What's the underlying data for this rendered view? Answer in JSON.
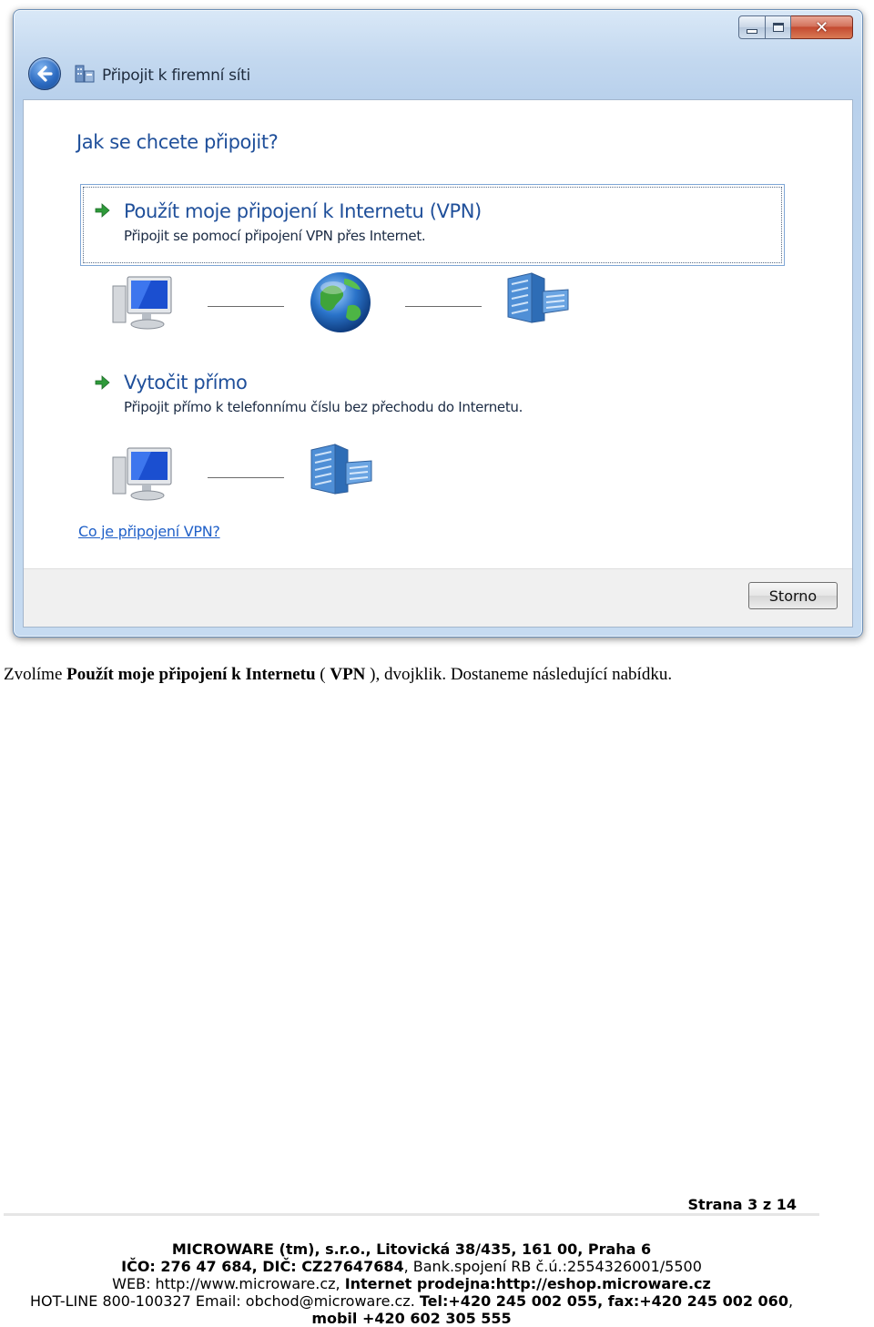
{
  "window": {
    "title": "Připojit k firemní síti",
    "question": "Jak se chcete připojit?",
    "options": [
      {
        "title": "Použít moje připojení k Internetu (VPN)",
        "desc": "Připojit se pomocí připojení VPN přes Internet."
      },
      {
        "title": "Vytočit přímo",
        "desc": "Připojit přímo k telefonnímu číslu bez přechodu do Internetu."
      }
    ],
    "help_link": "Co je připojení VPN?",
    "cancel_label": "Storno",
    "icons": [
      "back-arrow-icon",
      "network-icon",
      "computer-icon",
      "globe-icon",
      "server-building-icon",
      "green-arrow-icon"
    ]
  },
  "doc": {
    "p1_a": "Zvolíme ",
    "p1_b": "Použít moje připojení k Internetu",
    "p1_c": " ( ",
    "p1_d": "VPN",
    "p1_e": " ), dvojklik. Dostaneme následující nabídku."
  },
  "page": {
    "label": "Strana 3 z 14"
  },
  "footer": {
    "line1": "MICROWARE (tm), s.r.o., Litovická 38/435, 161 00, Praha 6",
    "line2_a": "IČO: 276 47 684,   DIČ: CZ27647684",
    "line2_b": ",     Bank.spojení RB č.ú.:2554326001/5500",
    "line3_a": "WEB: http://www.microware.cz, ",
    "line3_b": "Internet prodejna:http://eshop.microware.cz",
    "line4_a": "HOT-LINE  800-100327 Email: obchod@microware.cz. ",
    "line4_b": "Tel:+420 245 002 055,  fax:+420 245 002 060",
    "line4_c": ",",
    "line5": "mobil +420 602 305 555"
  },
  "colors": {
    "heading_blue": "#1f4f9a",
    "link_blue": "#2060c8",
    "arrow_green": "#2e9a3a"
  }
}
